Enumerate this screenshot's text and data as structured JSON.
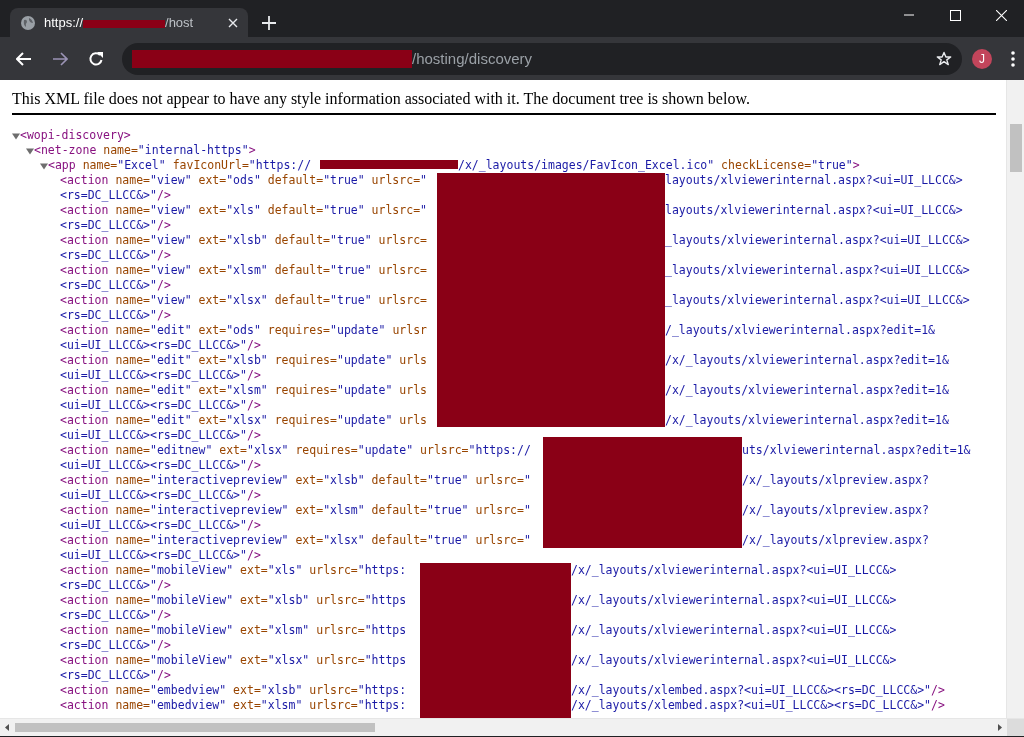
{
  "window": {
    "tab": {
      "title_start": "https://",
      "title_end": "/host",
      "selected": true
    },
    "address_bar": {
      "url_end": "/hosting/discovery"
    },
    "profile": {
      "initial": "J"
    }
  },
  "document": {
    "notice": "This XML file does not appear to have any style information associated with it. The document tree is shown below.",
    "tree": [
      {
        "kind": "tag",
        "text": "<wopi-discovery>",
        "expanded": true,
        "children": [
          {
            "kind": "tag",
            "text": "<net-zone name=\"internal-https\">",
            "expanded": true,
            "children": [
              {
                "kind": "tag",
                "text": "<app name=\"Excel\" favIconUrl=\"https://",
                "tail": "/x/_layouts/images/FavIcon_Excel.ico\" checkLicense=\"true\">",
                "expanded": true,
                "children": [
                  {
                    "kind": "tag",
                    "text": "<action name=\"view\" ext=\"ods\" default=\"true\" urlsrc=\"",
                    "tail": "layouts/xlviewerinternal.aspx?<ui=UI_LLCC&>"
                  },
                  {
                    "kind": "wrap",
                    "text": "<rs=DC_LLCC&>\"/>"
                  },
                  {
                    "kind": "tag",
                    "text": "<action name=\"view\" ext=\"xls\" default=\"true\" urlsrc=\"",
                    "tail": "layouts/xlviewerinternal.aspx?<ui=UI_LLCC&>"
                  },
                  {
                    "kind": "wrap",
                    "text": "<rs=DC_LLCC&>\"/>"
                  },
                  {
                    "kind": "tag",
                    "text": "<action name=\"view\" ext=\"xlsb\" default=\"true\" urlsrc=",
                    "tail": "_layouts/xlviewerinternal.aspx?<ui=UI_LLCC&>"
                  },
                  {
                    "kind": "wrap",
                    "text": "<rs=DC_LLCC&>\"/>"
                  },
                  {
                    "kind": "tag",
                    "text": "<action name=\"view\" ext=\"xlsm\" default=\"true\" urlsrc=",
                    "tail": "_layouts/xlviewerinternal.aspx?<ui=UI_LLCC&>"
                  },
                  {
                    "kind": "wrap",
                    "text": "<rs=DC_LLCC&>\"/>"
                  },
                  {
                    "kind": "tag",
                    "text": "<action name=\"view\" ext=\"xlsx\" default=\"true\" urlsrc=",
                    "tail": "_layouts/xlviewerinternal.aspx?<ui=UI_LLCC&>"
                  },
                  {
                    "kind": "wrap",
                    "text": "<rs=DC_LLCC&>\"/>"
                  },
                  {
                    "kind": "tag",
                    "text": "<action name=\"edit\" ext=\"ods\" requires=\"update\" urlsr",
                    "tail": "/_layouts/xlviewerinternal.aspx?edit=1&"
                  },
                  {
                    "kind": "wrap",
                    "text": "<ui=UI_LLCC&><rs=DC_LLCC&>\"/>"
                  },
                  {
                    "kind": "tag",
                    "text": "<action name=\"edit\" ext=\"xlsb\" requires=\"update\" urls",
                    "tail": "/x/_layouts/xlviewerinternal.aspx?edit=1&"
                  },
                  {
                    "kind": "wrap",
                    "text": "<ui=UI_LLCC&><rs=DC_LLCC&>\"/>"
                  },
                  {
                    "kind": "tag",
                    "text": "<action name=\"edit\" ext=\"xlsm\" requires=\"update\" urls",
                    "tail": "/x/_layouts/xlviewerinternal.aspx?edit=1&"
                  },
                  {
                    "kind": "wrap",
                    "text": "<ui=UI_LLCC&><rs=DC_LLCC&>\"/>"
                  },
                  {
                    "kind": "tag",
                    "text": "<action name=\"edit\" ext=\"xlsx\" requires=\"update\" urls",
                    "tail": "/x/_layouts/xlviewerinternal.aspx?edit=1&"
                  },
                  {
                    "kind": "wrap",
                    "text": "<ui=UI_LLCC&><rs=DC_LLCC&>\"/>"
                  },
                  {
                    "kind": "tag",
                    "text": "<action name=\"editnew\" ext=\"xlsx\" requires=\"update\" urlsrc=\"https://",
                    "tail": "uts/xlviewerinternal.aspx?edit=1&"
                  },
                  {
                    "kind": "wrap",
                    "text": "<ui=UI_LLCC&><rs=DC_LLCC&>\"/>"
                  },
                  {
                    "kind": "tag",
                    "text": "<action name=\"interactivepreview\" ext=\"xlsb\" default=\"true\" urlsrc=\"",
                    "tail": "/x/_layouts/xlpreview.aspx?"
                  },
                  {
                    "kind": "wrap",
                    "text": "<ui=UI_LLCC&><rs=DC_LLCC&>\"/>"
                  },
                  {
                    "kind": "tag",
                    "text": "<action name=\"interactivepreview\" ext=\"xlsm\" default=\"true\" urlsrc=\"",
                    "tail": "/x/_layouts/xlpreview.aspx?"
                  },
                  {
                    "kind": "wrap",
                    "text": "<ui=UI_LLCC&><rs=DC_LLCC&>\"/>"
                  },
                  {
                    "kind": "tag",
                    "text": "<action name=\"interactivepreview\" ext=\"xlsx\" default=\"true\" urlsrc=\"",
                    "tail": "/x/_layouts/xlpreview.aspx?"
                  },
                  {
                    "kind": "wrap",
                    "text": "<ui=UI_LLCC&><rs=DC_LLCC&>\"/>"
                  },
                  {
                    "kind": "tag",
                    "text": "<action name=\"mobileView\" ext=\"xls\" urlsrc=\"https:",
                    "tail": "/x/_layouts/xlviewerinternal.aspx?<ui=UI_LLCC&>"
                  },
                  {
                    "kind": "wrap",
                    "text": "<rs=DC_LLCC&>\"/>"
                  },
                  {
                    "kind": "tag",
                    "text": "<action name=\"mobileView\" ext=\"xlsb\" urlsrc=\"https",
                    "tail": "/x/_layouts/xlviewerinternal.aspx?<ui=UI_LLCC&>"
                  },
                  {
                    "kind": "wrap",
                    "text": "<rs=DC_LLCC&>\"/>"
                  },
                  {
                    "kind": "tag",
                    "text": "<action name=\"mobileView\" ext=\"xlsm\" urlsrc=\"https",
                    "tail": "/x/_layouts/xlviewerinternal.aspx?<ui=UI_LLCC&>"
                  },
                  {
                    "kind": "wrap",
                    "text": "<rs=DC_LLCC&>\"/>"
                  },
                  {
                    "kind": "tag",
                    "text": "<action name=\"mobileView\" ext=\"xlsx\" urlsrc=\"https",
                    "tail": "/x/_layouts/xlviewerinternal.aspx?<ui=UI_LLCC&>"
                  },
                  {
                    "kind": "wrap",
                    "text": "<rs=DC_LLCC&>\"/>"
                  },
                  {
                    "kind": "tag",
                    "text": "<action name=\"embedview\" ext=\"xlsb\" urlsrc=\"https:",
                    "tail": "/x/_layouts/xlembed.aspx?<ui=UI_LLCC&><rs=DC_LLCC&>\"/>"
                  },
                  {
                    "kind": "tag",
                    "text": "<action name=\"embedview\" ext=\"xlsm\" urlsrc=\"https:",
                    "tail": "/x/_layouts/xlembed.aspx?<ui=UI_LLCC&><rs=DC_LLCC&>\"/>"
                  }
                ]
              }
            ]
          }
        ]
      }
    ]
  }
}
